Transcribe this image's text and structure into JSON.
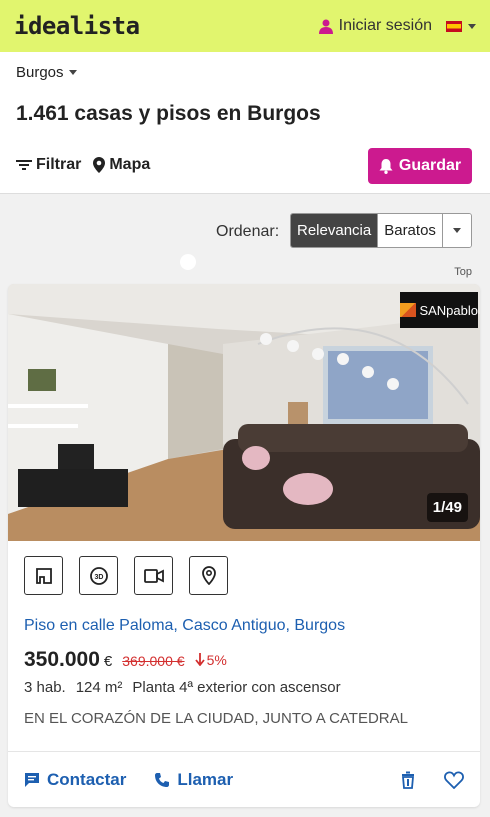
{
  "topbar": {
    "logo": "idealista",
    "login_label": "Iniciar sesión",
    "flag_icon": "spain-flag-icon"
  },
  "header": {
    "location": "Burgos",
    "title": "1.461 casas y pisos en Burgos",
    "filter_label": "Filtrar",
    "map_label": "Mapa",
    "save_label": "Guardar"
  },
  "sort": {
    "label": "Ordenar:",
    "options": [
      "Relevancia",
      "Baratos"
    ],
    "active": "Relevancia"
  },
  "top_label": "Top",
  "listing": {
    "agency": "SANpablo",
    "photo_counter": "1/49",
    "title": "Piso en calle Paloma, Casco Antiguo, Burgos",
    "price": "350.000",
    "currency": "€",
    "old_price": "369.000 €",
    "discount": "5%",
    "details": [
      "3 hab.",
      "124 m²",
      "Planta 4ª exterior con ascensor"
    ],
    "description": "EN EL CORAZÓN DE LA CIUDAD, JUNTO A CATEDRAL",
    "contact_label": "Contactar",
    "call_label": "Llamar"
  },
  "colors": {
    "brand_bar": "#e1f56e",
    "save_button": "#cc1a8f",
    "link": "#1d5fb0",
    "discount": "#d32f2f"
  }
}
